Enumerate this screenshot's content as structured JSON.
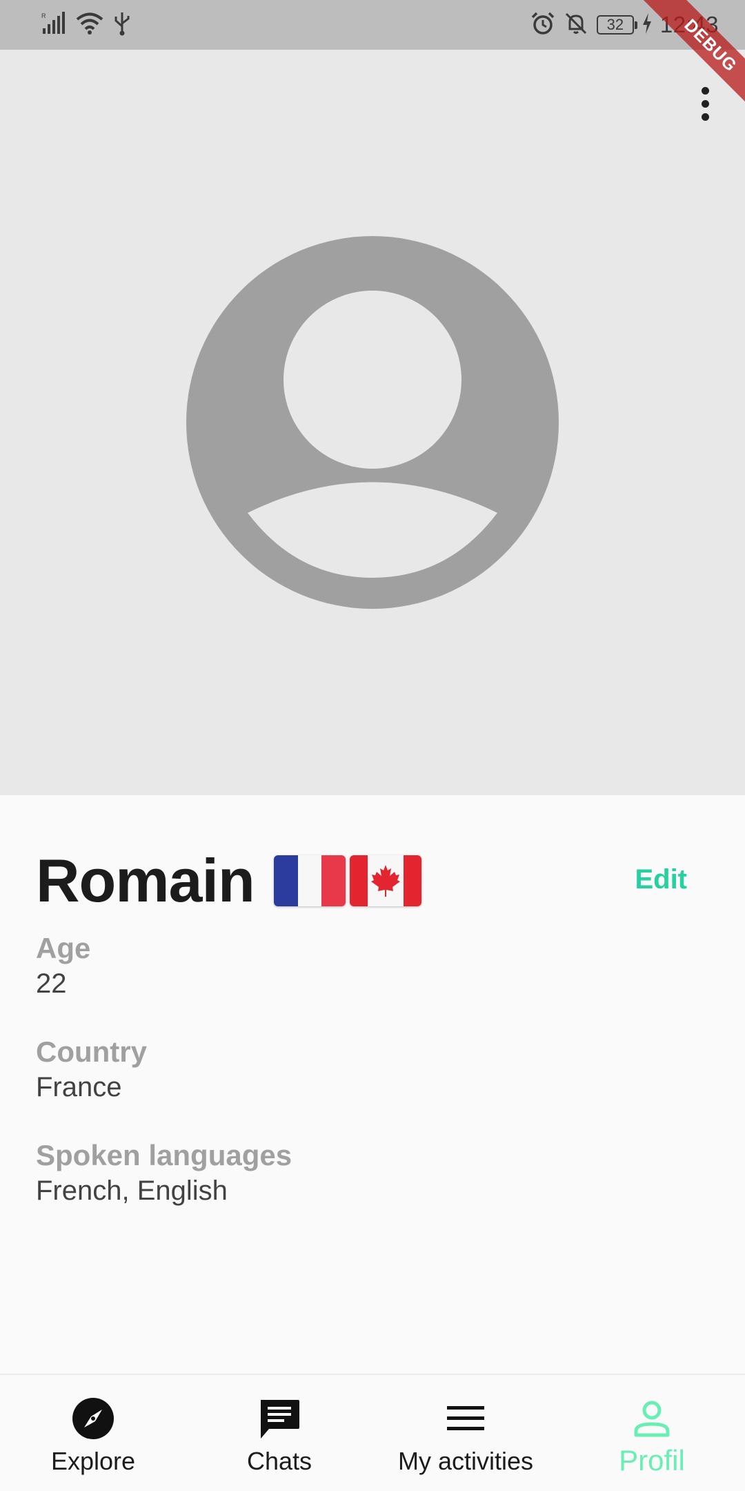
{
  "status_bar": {
    "time": "12:43",
    "battery": "32",
    "left_icons": [
      "signal-icon",
      "wifi-icon",
      "usb-icon"
    ],
    "right_icons": [
      "alarm-icon",
      "bell-off-icon",
      "battery-icon",
      "charging-icon"
    ]
  },
  "debug_banner": "DEBUG",
  "header": {
    "menu_icon": "more-vert-icon",
    "avatar_icon": "account-circle-icon",
    "background": "#e8e8e8",
    "avatar_color": "#a0a0a0"
  },
  "profile": {
    "name": "Romain",
    "flags": [
      "france-flag-icon",
      "canada-flag-icon"
    ],
    "edit_label": "Edit",
    "fields": [
      {
        "label": "Age",
        "value": "22"
      },
      {
        "label": "Country",
        "value": "France"
      },
      {
        "label": "Spoken languages",
        "value": "French, English"
      }
    ]
  },
  "bottom_nav": {
    "items": [
      {
        "label": "Explore",
        "icon": "compass-icon",
        "active": false
      },
      {
        "label": "Chats",
        "icon": "chat-icon",
        "active": false
      },
      {
        "label": "My activities",
        "icon": "menu-icon",
        "active": false
      },
      {
        "label": "Profil",
        "icon": "person-icon",
        "active": true
      }
    ],
    "active_color": "#69eeb3"
  },
  "colors": {
    "accent": "#26d0a0",
    "label_gray": "#a0a0a0"
  }
}
